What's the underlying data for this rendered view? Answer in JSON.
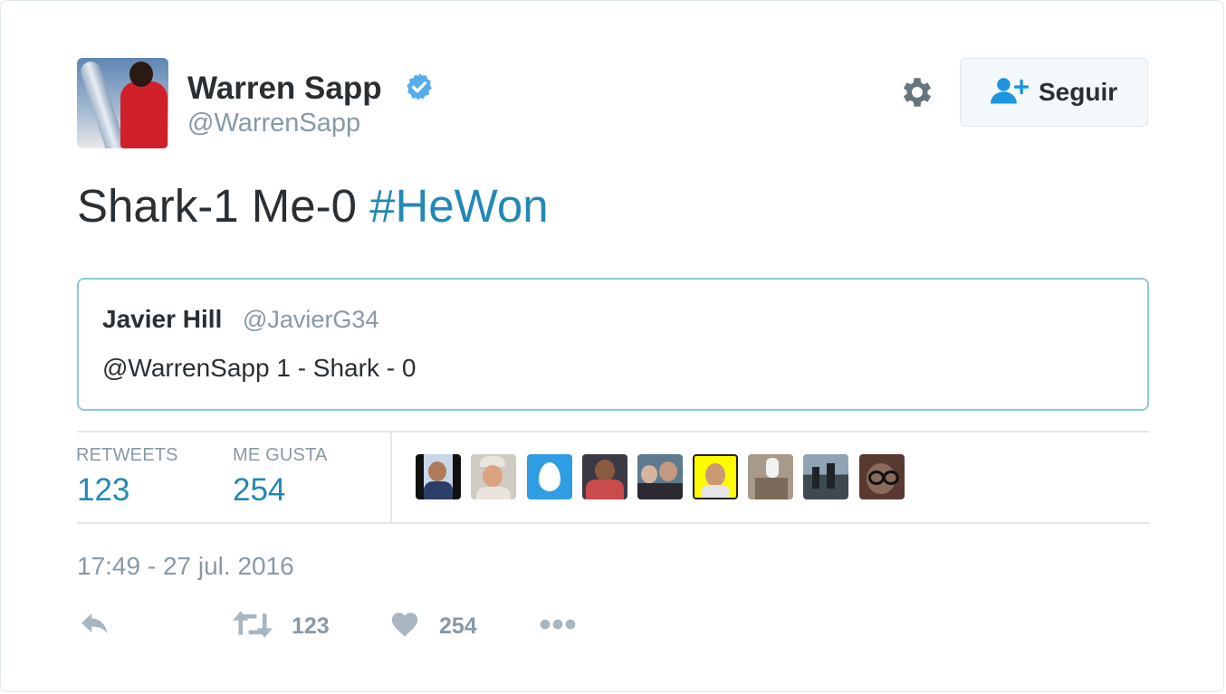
{
  "user": {
    "name": "Warren Sapp",
    "handle": "@WarrenSapp",
    "verified_icon": "verified-badge-icon"
  },
  "follow_button": {
    "label": "Seguir",
    "icon": "add-user-icon"
  },
  "tweet": {
    "text": "Shark-1 Me-0 ",
    "hashtag": "#HeWon"
  },
  "quoted_tweet": {
    "name": "Javier Hill",
    "handle": "@JavierG34",
    "text": "@WarrenSapp 1 - Shark - 0"
  },
  "stats": {
    "retweets_label": "RETWEETS",
    "retweets_value": "123",
    "likes_label": "ME GUSTA",
    "likes_value": "254"
  },
  "likers": [
    {
      "icon": "liker-avatar-1"
    },
    {
      "icon": "liker-avatar-2"
    },
    {
      "icon": "default-egg-avatar"
    },
    {
      "icon": "liker-avatar-4"
    },
    {
      "icon": "liker-avatar-5"
    },
    {
      "icon": "snapcode-avatar"
    },
    {
      "icon": "liker-avatar-7"
    },
    {
      "icon": "liker-avatar-8"
    },
    {
      "icon": "liker-avatar-9"
    }
  ],
  "timestamp": "17:49 - 27 jul. 2016",
  "actions": {
    "retweet_count": "123",
    "like_count": "254"
  },
  "colors": {
    "link": "#2289b5",
    "muted": "#8899a6",
    "text": "#292f33",
    "verified": "#55acee",
    "quote_border": "#8ec8d7"
  }
}
